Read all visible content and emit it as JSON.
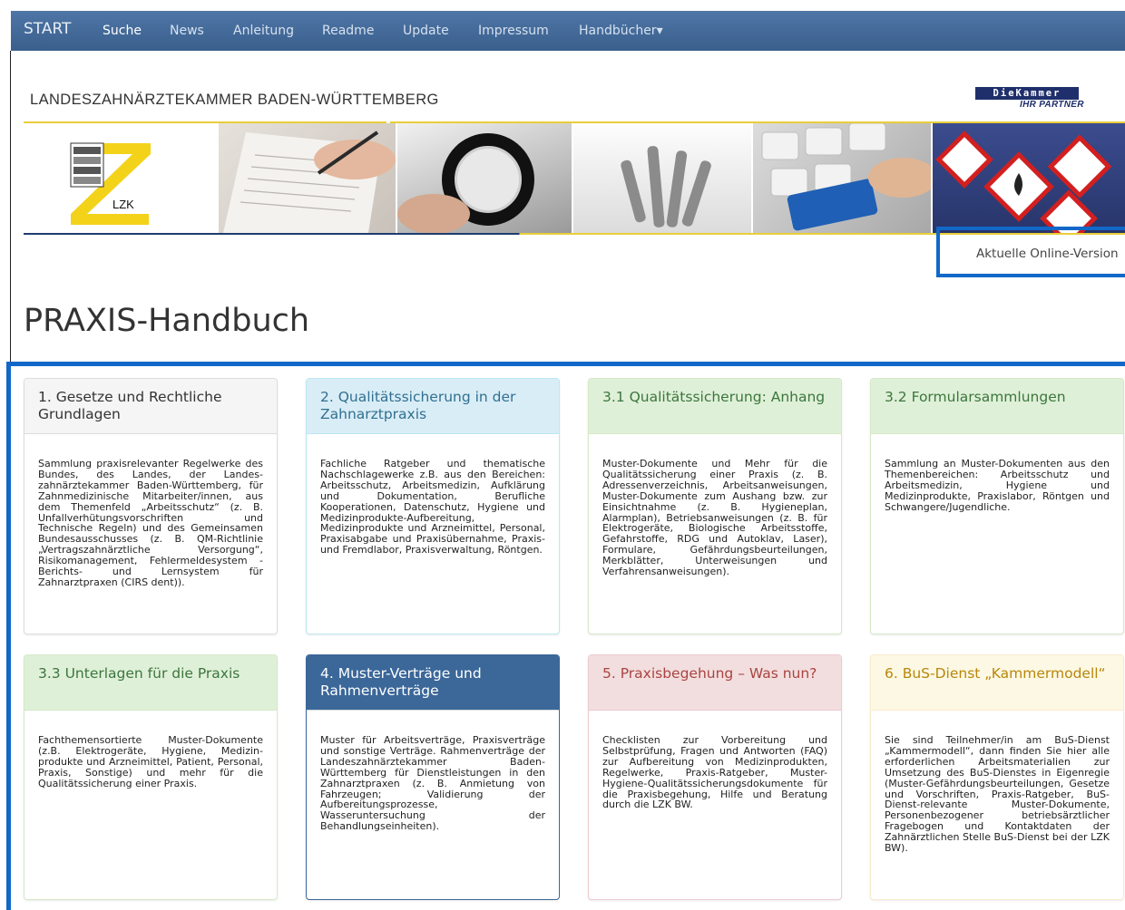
{
  "nav": {
    "brand": "START",
    "items": [
      "Suche",
      "News",
      "Anleitung",
      "Readme",
      "Update",
      "Impressum",
      "Handbücher▾"
    ],
    "active_index": 0
  },
  "header": {
    "org_title": "LANDESZAHNÄRZTEKAMMER BADEN-WÜRTTEMBERG",
    "kammer_logo": "DieKammer",
    "kammer_slogan": "IHR PARTNER",
    "lzk_logo": "LZK"
  },
  "online_version": "Aktuelle Online-Version",
  "page_title": "PRAXIS-Handbuch",
  "cards": [
    {
      "title": "1. Gesetze und Rechtliche Grundlagen",
      "style": "default",
      "text": "Sammlung praxisrelevanter Regelwerke des Bundes, des Landes, der Landes­zahnärztekammer Baden-Württemberg, für Zahnmedizinische Mitarbeiter/innen, aus dem Themenfeld „Arbeitsschutz“ (z. B. Unfallverhütungsvorschriften und Technische Regeln) und des Gemeinsamen Bundesausschusses (z. B. QM-Richtlinie „Vertragszahnärztliche Ver­sorgung“, Risikomanagement, Fehler­meldesystem - Berichts- und Lernsystem für Zahnarztpraxen (CIRS dent))."
    },
    {
      "title": "2. Qualitätssicherung in der Zahnarztpraxis",
      "style": "info",
      "text": "Fachliche Ratgeber und thematische Nachschlagewerke z.B. aus den Bereichen: Arbeitsschutz, Arbeits­medizin, Aufklärung und Dokumentation, Berufliche Kooperationen, Datenschutz, Hygiene und Medizinprodukte-Aufbereitung, Medizinprodukte und Arzneimittel, Personal, Praxisabgabe und Praxisübernahme, Praxis- und Fremdlabor, Praxisverwaltung, Röntgen."
    },
    {
      "title": "3.1 Qualitätssicherung: Anhang",
      "style": "success",
      "text": "Muster-Dokumente und Mehr für die Qualitätssicherung einer Praxis (z. B. Adressenverzeichnis, Arbeits­anweisungen, Muster-Dokumente zum Aushang bzw. zur Einsichtnahme (z. B. Hygieneplan, Alarmplan), Betriebs­anweisungen (z. B. für Elektrogeräte, Biologische Arbeitsstoffe, Gefahrstoffe, RDG und Autoklav, Laser), Formulare, Gefährdungsbeurteilungen, Merkblätter, Unterweisungen und Verfahrens­anweisungen)."
    },
    {
      "title": "3.2 Formularsammlungen",
      "style": "success",
      "text": "Sammlung an Muster-Dokumenten aus den Themenbereichen: Arbeitsschutz und Arbeitsmedizin, Hygiene und Medizinprodukte, Praxislabor, Röntgen und Schwangere/Jugendliche."
    },
    {
      "title": "3.3 Unterlagen für die Praxis",
      "style": "success",
      "text": "Fachthemensortierte Muster-Dokumente (z.B. Elektrogeräte, Hygiene, Medizin­produkte und Arzneimittel, Patient, Personal, Praxis, Sonstige) und mehr für die Qualitätssicherung einer Praxis."
    },
    {
      "title": "4. Muster-Verträge und Rahmenverträge",
      "style": "primary",
      "text": "Muster für Arbeitsverträge, Praxis­verträge und sonstige Verträge. Rahmenverträge der Landes­zahnärztekammer Baden-Württemberg für Dienstleistungen in den Zahnarzt­praxen (z. B. Anmietung von Fahrzeugen; Validierung der Aufbereitungsprozesse, Wasseruntersuchung der Behandlungseinheiten)."
    },
    {
      "title": "5. Praxisbegehung – Was nun?",
      "style": "danger",
      "text": "Checklisten zur Vorbereitung und Selbstprüfung, Fragen und Antworten (FAQ) zur Aufbereitung von Medizinprodukten, Regelwerke, Praxis-Ratgeber, Muster-Hygiene-Qualitäts­sicherungsdokumente für die Praxis­begehung, Hilfe und Beratung durch die LZK BW."
    },
    {
      "title": "6. BuS-Dienst „Kammermodell“",
      "style": "warning",
      "text": "Sie sind Teilnehmer/in am BuS-Dienst „Kammermodell“, dann finden Sie hier alle erforderlichen Arbeitsmaterialien zur Umsetzung des BuS-Dienstes in Eigenregie (Muster-Gefährdungs­beurteilungen, Gesetze und Vorschriften, Praxis-Ratgeber, BuS-Dienst-relevante Muster-Dokumente, Personenbezogener betriebsärztlicher Fragebogen und Kontaktdaten der Zahnärztlichen Stelle BuS-Dienst bei der LZK BW)."
    }
  ]
}
